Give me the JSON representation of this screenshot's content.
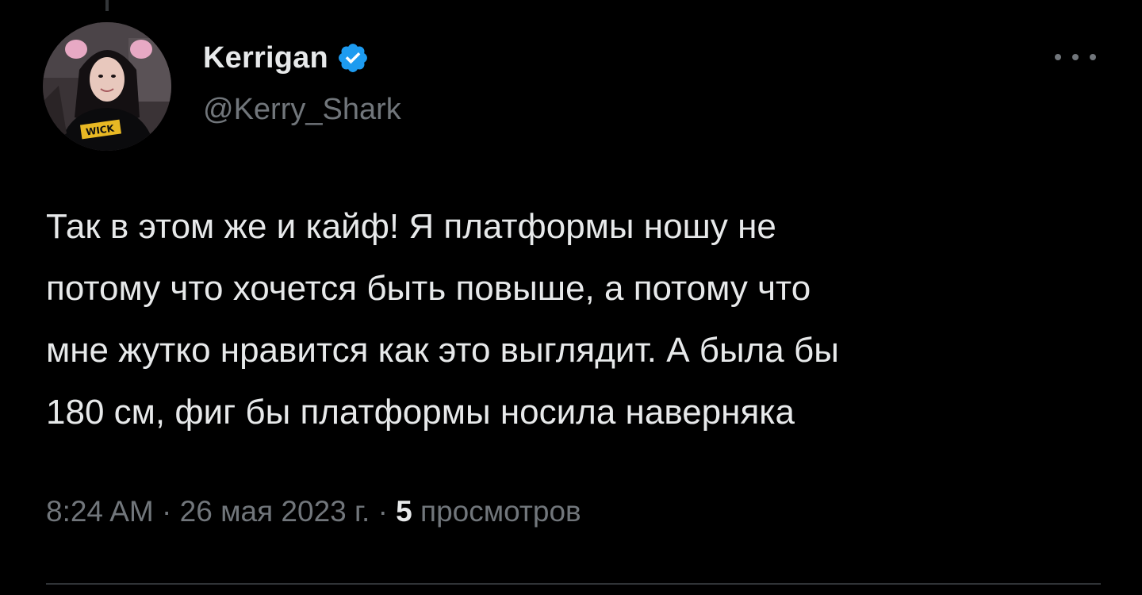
{
  "author": {
    "display_name": "Kerrigan",
    "handle": "@Kerry_Shark",
    "verified_color": "#1d9bf0",
    "avatar_icon": "profile-photo",
    "avatar_shirt_text": "WICK"
  },
  "tweet": {
    "lines": [
      "Так в этом же и кайф! Я платформы ношу не",
      "потому что хочется быть повыше, а потому что",
      "мне жутко нравится как это выглядит. А была бы",
      "180 см, фиг бы платформы носила наверняка"
    ]
  },
  "meta": {
    "time": "8:24 AM",
    "separator": "·",
    "date": "26 мая 2023 г.",
    "views_count": "5",
    "views_label": "просмотров"
  },
  "icons": {
    "more": "more-dots-icon",
    "verified": "verified-badge-icon"
  },
  "colors": {
    "background": "#000000",
    "primary_text": "#e7e9ea",
    "secondary_text": "#71767b",
    "accent": "#1d9bf0"
  }
}
